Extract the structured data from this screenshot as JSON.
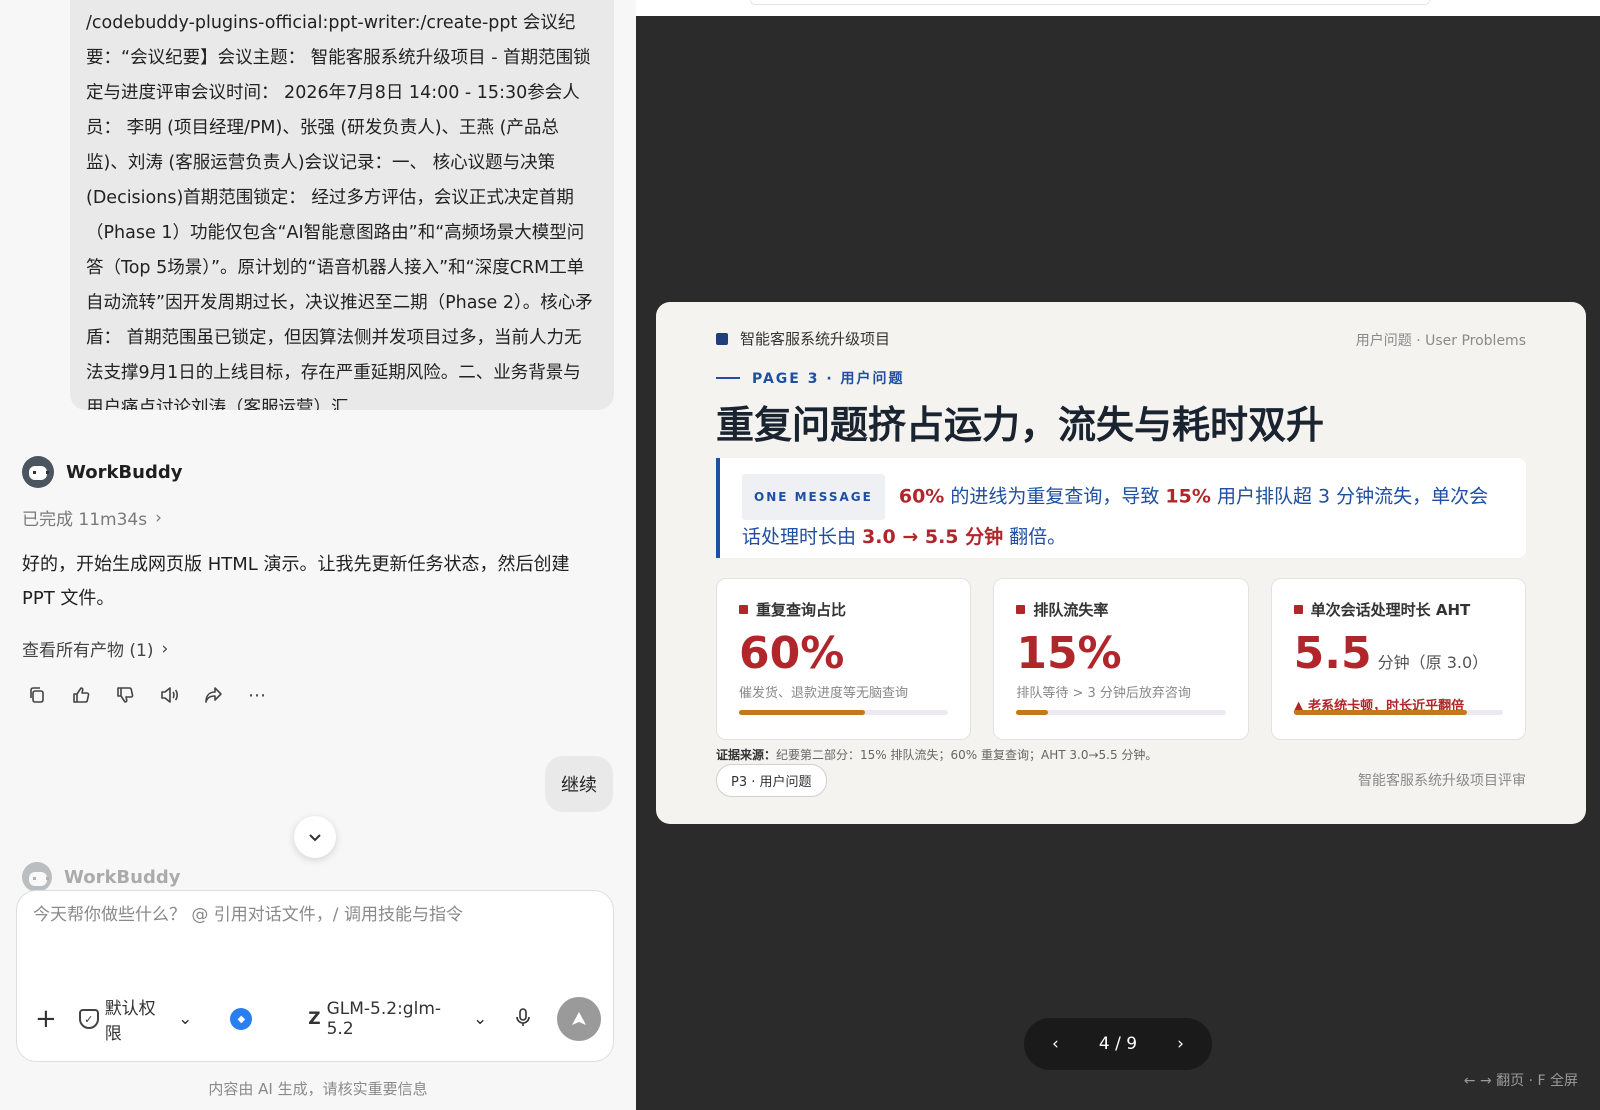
{
  "chat": {
    "user_message": "/codebuddy-plugins-official:ppt-writer:/create-ppt 会议纪要：“会议纪要】会议主题： 智能客服系统升级项目 - 首期范围锁定与进度评审会议时间： 2026年7月8日 14:00 - 15:30参会人员： 李明 (项目经理/PM)、张强 (研发负责人)、王燕 (产品总监)、刘涛 (客服运营负责人)会议记录：一、 核心议题与决策 (Decisions)首期范围锁定： 经过多方评估，会议正式决定首期（Phase 1）功能仅包含“AI智能意图路由”和“高频场景大模型问答（Top 5场景）”。原计划的“语音机器人接入”和“深度CRM工单自动流转”因开发周期过长，决议推迟至二期（Phase 2）。核心矛盾： 首期范围虽已锁定，但因算法侧并发项目过多，当前人力无法支撑9月1日的上线目标，存在严重延期风险。二、业务背景与用户痛点讨论刘涛（客服运营）汇",
    "assistant_name": "WorkBuddy",
    "status": "已完成 11m34s",
    "reply": "好的，开始生成网页版 HTML 演示。让我先更新任务状态，然后创建 PPT 文件。",
    "artifacts_link": "查看所有产物 (1)",
    "followup": "继续",
    "ghost_name": "WorkBuddy"
  },
  "composer": {
    "placeholder": "今天帮你做些什么？ @ 引用对话文件，/ 调用技能与指令",
    "permission": "默认权限",
    "model": "GLM-5.2:glm-5.2",
    "disclaimer": "内容由 AI 生成，请核实重要信息"
  },
  "slide": {
    "brand": "智能客服系统升级项目",
    "top_right": "用户问题 · User Problems",
    "kicker": "PAGE 3 · 用户问题",
    "title": "重复问题挤占运力，流失与耗时双升",
    "message_tag": "ONE MESSAGE",
    "message": {
      "p1": "60%",
      "t1": " 的进线为重复查询，导致 ",
      "p2": "15%",
      "t2": " 用户排队超 3 分钟流失，单次会话处理时长由 ",
      "p3": "3.0 → 5.5 分钟",
      "t3": " 翻倍。"
    },
    "cards": [
      {
        "label": "重复查询占比",
        "value": "60%",
        "sub": "催发货、退款进度等无脑查询",
        "progress": 0.6
      },
      {
        "label": "排队流失率",
        "value": "15%",
        "sub": "排队等待 > 3 分钟后放弃咨询",
        "progress": 0.15
      },
      {
        "label": "单次会话处理时长 AHT",
        "value": "5.5",
        "unit": "分钟（原 3.0）",
        "warn": "▲ 老系统卡顿，时长近乎翻倍",
        "progress": 0.83
      }
    ],
    "source_label": "证据来源：",
    "source_text": "纪要第二部分：15% 排队流失；60% 重复查询；AHT 3.0→5.5 分钟。",
    "page_pill": "P3 · 用户问题",
    "footer": "智能客服系统升级项目评审"
  },
  "pager": {
    "prev": "‹",
    "label": "4 / 9",
    "next": "›",
    "hint": "← → 翻页 · F 全屏"
  },
  "colors": {
    "accent_blue": "#1e4fa0",
    "accent_red": "#b0262b",
    "bar_fill": "#c07a1a",
    "preview_bg": "#2b2b2b"
  }
}
